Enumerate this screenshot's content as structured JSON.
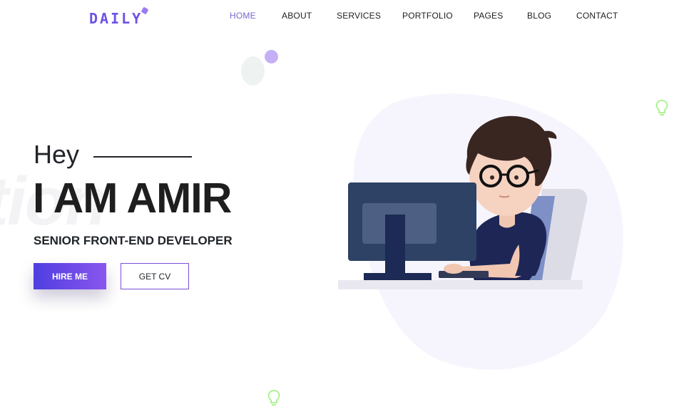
{
  "brand": {
    "logo_text": "DAILY"
  },
  "nav": {
    "items": [
      {
        "label": "HOME",
        "active": true
      },
      {
        "label": "ABOUT",
        "active": false
      },
      {
        "label": "SERVICES",
        "active": false
      },
      {
        "label": "PORTFOLIO",
        "active": false
      },
      {
        "label": "PAGES",
        "active": false
      },
      {
        "label": "BLOG",
        "active": false
      },
      {
        "label": "CONTACT",
        "active": false
      }
    ]
  },
  "hero": {
    "greeting": "Hey",
    "name": "I AM AMIR",
    "role": "SENIOR FRONT-END DEVELOPER",
    "background_word": "tion",
    "hire_button": "HIRE ME",
    "cv_button": "GET CV"
  },
  "colors": {
    "accent": "#7668cf",
    "button_gradient_start": "#4e3fe0",
    "button_gradient_end": "#8a55ee",
    "bulb": "#a6f08a"
  },
  "icons": [
    "lightbulb-icon",
    "lightbulb-icon"
  ]
}
